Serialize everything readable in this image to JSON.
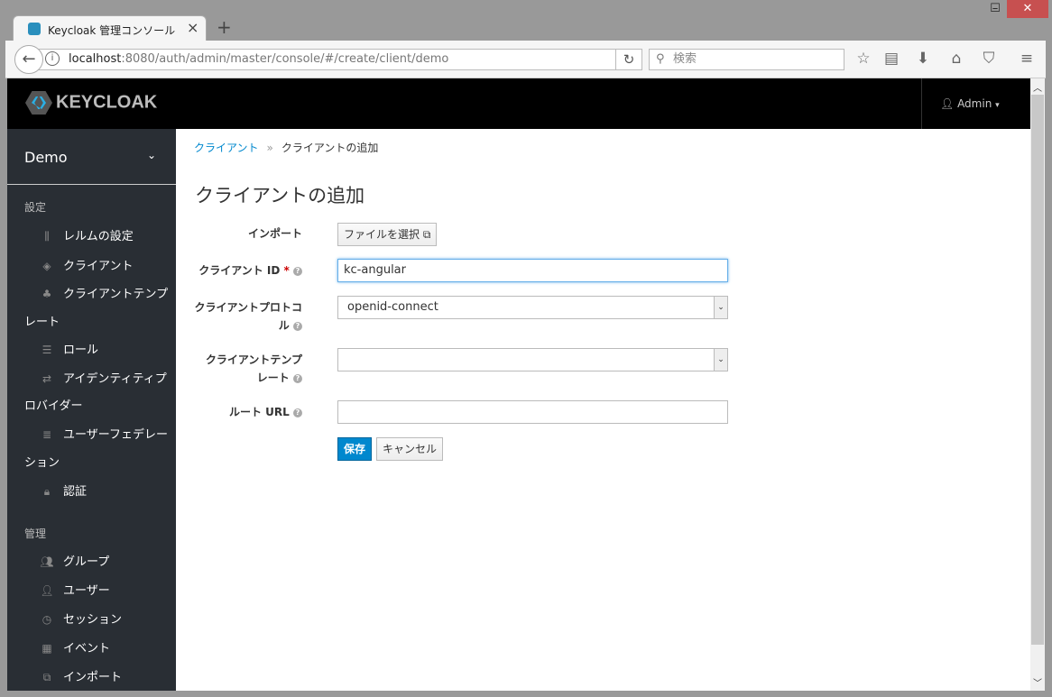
{
  "browser": {
    "tab_title": "Keycloak 管理コンソール",
    "url_host": "localhost",
    "url_path": ":8080/auth/admin/master/console/#/create/client/demo",
    "search_placeholder": "検索"
  },
  "header": {
    "logo": "KEYCLOAK",
    "user": "Admin"
  },
  "sidebar": {
    "realm": "Demo",
    "section1": "設定",
    "section2": "管理",
    "items1": [
      {
        "label": "レルムの設定",
        "icon": "sliders-icon"
      },
      {
        "label": "クライアント",
        "icon": "cube-icon"
      },
      {
        "label": "クライアントテンプ",
        "label2": "レート",
        "icon": "cubes-icon"
      },
      {
        "label": "ロール",
        "icon": "list-icon"
      },
      {
        "label": "アイデンティティプ",
        "label2": "ロバイダー",
        "icon": "exchange-icon"
      },
      {
        "label": "ユーザーフェデレー",
        "label2": "ション",
        "icon": "database-icon"
      },
      {
        "label": "認証",
        "icon": "lock-icon"
      }
    ],
    "items2": [
      {
        "label": "グループ",
        "icon": "users-icon"
      },
      {
        "label": "ユーザー",
        "icon": "user-icon"
      },
      {
        "label": "セッション",
        "icon": "clock-icon"
      },
      {
        "label": "イベント",
        "icon": "calendar-icon"
      },
      {
        "label": "インポート",
        "icon": "import-icon"
      }
    ]
  },
  "main": {
    "breadcrumb_link": "クライアント",
    "breadcrumb_sep": "»",
    "breadcrumb_current": "クライアントの追加",
    "title": "クライアントの追加",
    "import_label": "インポート",
    "file_button": "ファイルを選択",
    "client_id_label": "クライアント ID",
    "required": "*",
    "client_id_value": "kc-angular",
    "protocol_label1": "クライアントプロトコ",
    "protocol_label2": "ル",
    "protocol_value": "openid-connect",
    "template_label1": "クライアントテンプ",
    "template_label2": "レート",
    "template_value": "",
    "root_url_label": "ルート URL",
    "root_url_value": "",
    "save": "保存",
    "cancel": "キャンセル"
  }
}
